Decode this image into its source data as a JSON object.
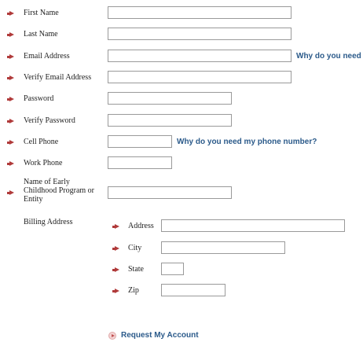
{
  "form": {
    "first_name": {
      "label": "First Name",
      "value": ""
    },
    "last_name": {
      "label": "Last Name",
      "value": ""
    },
    "email": {
      "label": "Email Address",
      "value": "",
      "help": "Why do you need"
    },
    "verify_email": {
      "label": "Verify Email Address",
      "value": ""
    },
    "password": {
      "label": "Password",
      "value": ""
    },
    "verify_password": {
      "label": "Verify Password",
      "value": ""
    },
    "cell_phone": {
      "label": "Cell Phone",
      "value": "",
      "help": "Why do you need my phone number?"
    },
    "work_phone": {
      "label": "Work Phone",
      "value": ""
    },
    "program": {
      "label": "Name of Early Childhood Program or Entity",
      "value": ""
    },
    "billing": {
      "label": "Billing Address",
      "address": {
        "label": "Address",
        "value": ""
      },
      "city": {
        "label": "City",
        "value": ""
      },
      "state": {
        "label": "State",
        "value": ""
      },
      "zip": {
        "label": "Zip",
        "value": ""
      }
    },
    "submit_label": "Request My Account"
  },
  "colors": {
    "bullet": "#b03a3a",
    "link": "#2b5a8a",
    "input_border": "#9a9a9a"
  },
  "icons": {
    "bullet": "arrow-right-icon",
    "submit": "arrow-circle-icon"
  }
}
